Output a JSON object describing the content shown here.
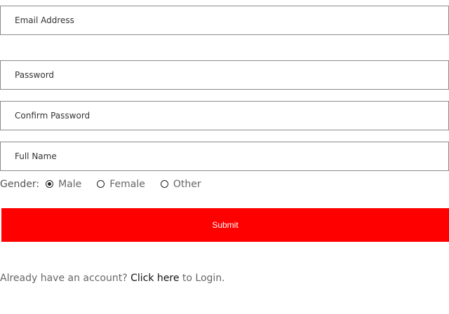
{
  "form": {
    "email": {
      "placeholder": "Email Address",
      "value": ""
    },
    "password": {
      "placeholder": "Password",
      "value": ""
    },
    "confirm_password": {
      "placeholder": "Confirm Password",
      "value": ""
    },
    "full_name": {
      "placeholder": "Full Name",
      "value": ""
    },
    "gender": {
      "label": "Gender:",
      "options": [
        {
          "label": "Male",
          "selected": true
        },
        {
          "label": "Female",
          "selected": false
        },
        {
          "label": "Other",
          "selected": false
        }
      ]
    },
    "submit_label": "Submit"
  },
  "login_prompt": {
    "prefix": "Already have an account?",
    "link_text": "Click here",
    "suffix": "to Login."
  },
  "colors": {
    "submit_bg": "#ff0000",
    "submit_text": "#ffffff",
    "border": "#8a8a8a"
  }
}
